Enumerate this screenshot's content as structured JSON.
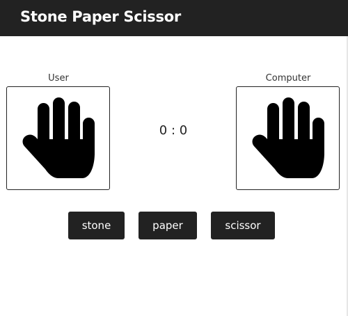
{
  "header": {
    "title": "Stone Paper Scissor",
    "bg_color": "#222222"
  },
  "game": {
    "user_label": "User",
    "computer_label": "Computer",
    "user_hand": "hand-paper-icon",
    "computer_hand": "hand-paper-icon",
    "score": "0 : 0"
  },
  "choices": {
    "stone": "stone",
    "paper": "paper",
    "scissor": "scissor"
  }
}
